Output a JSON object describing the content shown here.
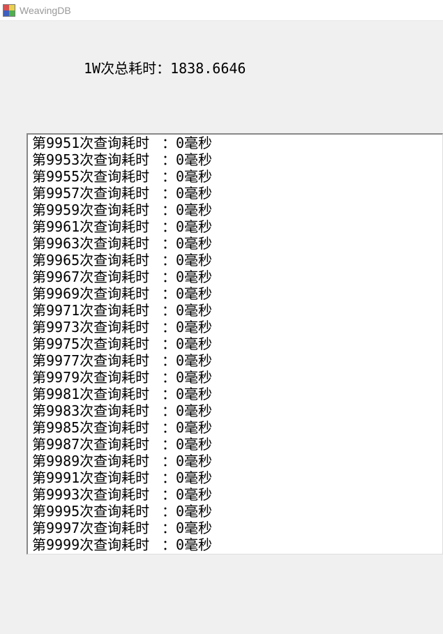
{
  "window": {
    "title": "WeavingDB"
  },
  "summary": {
    "label": "1W次总耗时：",
    "value": "1838.6646"
  },
  "log": {
    "col1_prefix": "第",
    "col1_suffix": "次查询耗时",
    "col2_text": "：0毫秒",
    "visible_rows": [
      {
        "n": "9951"
      },
      {
        "n": "9953"
      },
      {
        "n": "9955"
      },
      {
        "n": "9957"
      },
      {
        "n": "9959"
      },
      {
        "n": "9961"
      },
      {
        "n": "9963"
      },
      {
        "n": "9965"
      },
      {
        "n": "9967"
      },
      {
        "n": "9969"
      },
      {
        "n": "9971"
      },
      {
        "n": "9973"
      },
      {
        "n": "9975"
      },
      {
        "n": "9977"
      },
      {
        "n": "9979"
      },
      {
        "n": "9981"
      },
      {
        "n": "9983"
      },
      {
        "n": "9985"
      },
      {
        "n": "9987"
      },
      {
        "n": "9989"
      },
      {
        "n": "9991"
      },
      {
        "n": "9993"
      },
      {
        "n": "9995"
      },
      {
        "n": "9997"
      },
      {
        "n": "9999"
      }
    ]
  }
}
